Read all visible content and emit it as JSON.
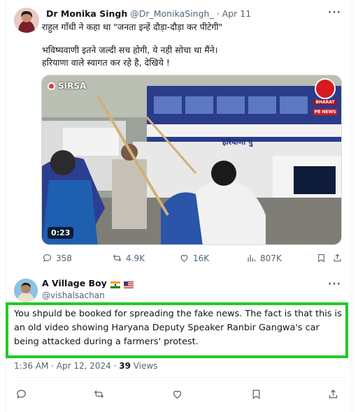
{
  "tweet1": {
    "author_name": "Dr Monika Singh",
    "handle": "@Dr_MonikaSingh_",
    "separator": "·",
    "date": "Apr 11",
    "lines": [
      "राहुल गाँधी ने कहा था \"जनता इन्हें दौड़ा-दौड़ा कर पीटेगी\"",
      "भविष्यवाणी इतने जल्दी सच होगी, ये नही सोचा था मैंने।",
      "हरियाणा वाले स्वागत कर रहे है, देखिये !"
    ],
    "video": {
      "location_label": "SIRSA",
      "brand_name": "BHARAT",
      "brand_sub": "PB NEWS",
      "bus_text": "हरियाणा पु",
      "duration": "0:23"
    },
    "stats": {
      "replies": "358",
      "reposts": "4.9K",
      "likes": "16K",
      "views": "807K"
    }
  },
  "tweet2": {
    "author_name": "A Village Boy",
    "handle": "@vishalsachan",
    "lines": [
      "You shpuld be booked for spreading the fake news. The fact is that this is",
      "an old video showing Haryana Deputy Speaker Ranbir Gangwa's car",
      "being attacked during a farmers' protest."
    ],
    "time": "1:36 AM · Apr 12, 2024 ·",
    "views_count": "39",
    "views_label": "Views"
  },
  "colors": {
    "highlight": "#22c82a",
    "muted": "#536471",
    "text": "#0f1419"
  }
}
